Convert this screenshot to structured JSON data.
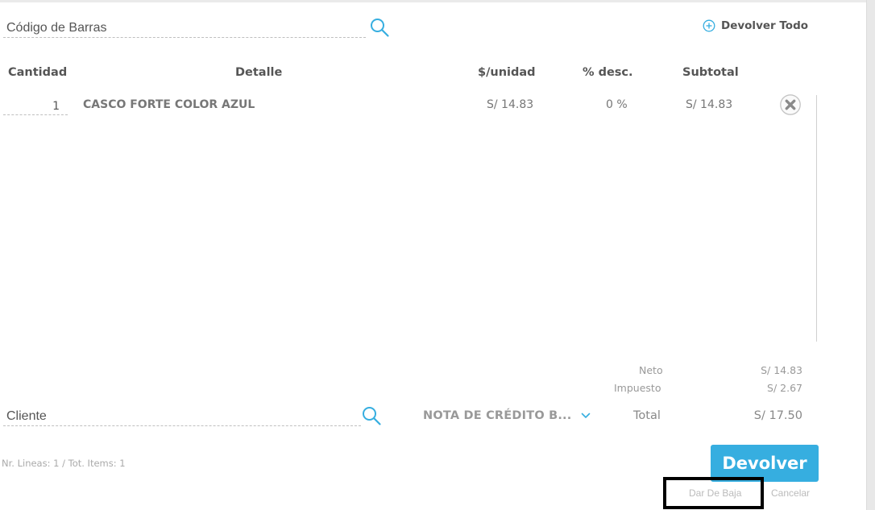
{
  "barcode": {
    "placeholder": "Código de Barras",
    "value": ""
  },
  "return_all_label": "Devolver Todo",
  "columns": {
    "qty": "Cantidad",
    "detail": "Detalle",
    "unit_price": "$/unidad",
    "discount": "% desc.",
    "subtotal": "Subtotal"
  },
  "items": [
    {
      "qty": "1",
      "detail": "CASCO FORTE COLOR AZUL",
      "unit_price": "S/ 14.83",
      "discount": "0 %",
      "subtotal": "S/ 14.83"
    }
  ],
  "summary": {
    "net_label": "Neto",
    "net_value": "S/ 14.83",
    "tax_label": "Impuesto",
    "tax_value": "S/ 2.67",
    "total_label": "Total",
    "total_value": "S/ 17.50"
  },
  "client": {
    "placeholder": "Cliente",
    "value": ""
  },
  "document_type": "NOTA DE CRÉDITO B...",
  "stats": "Nr. Lineas: 1 / Tot. Items: 1",
  "actions": {
    "return_label": "Devolver",
    "discard_label": "Dar De Baja",
    "cancel_label": "Cancelar"
  },
  "colors": {
    "accent": "#36aee0",
    "highlight": "#000000"
  },
  "icons": [
    "search-icon",
    "plus-circle-icon",
    "close-circle-icon",
    "chevron-down-icon"
  ]
}
